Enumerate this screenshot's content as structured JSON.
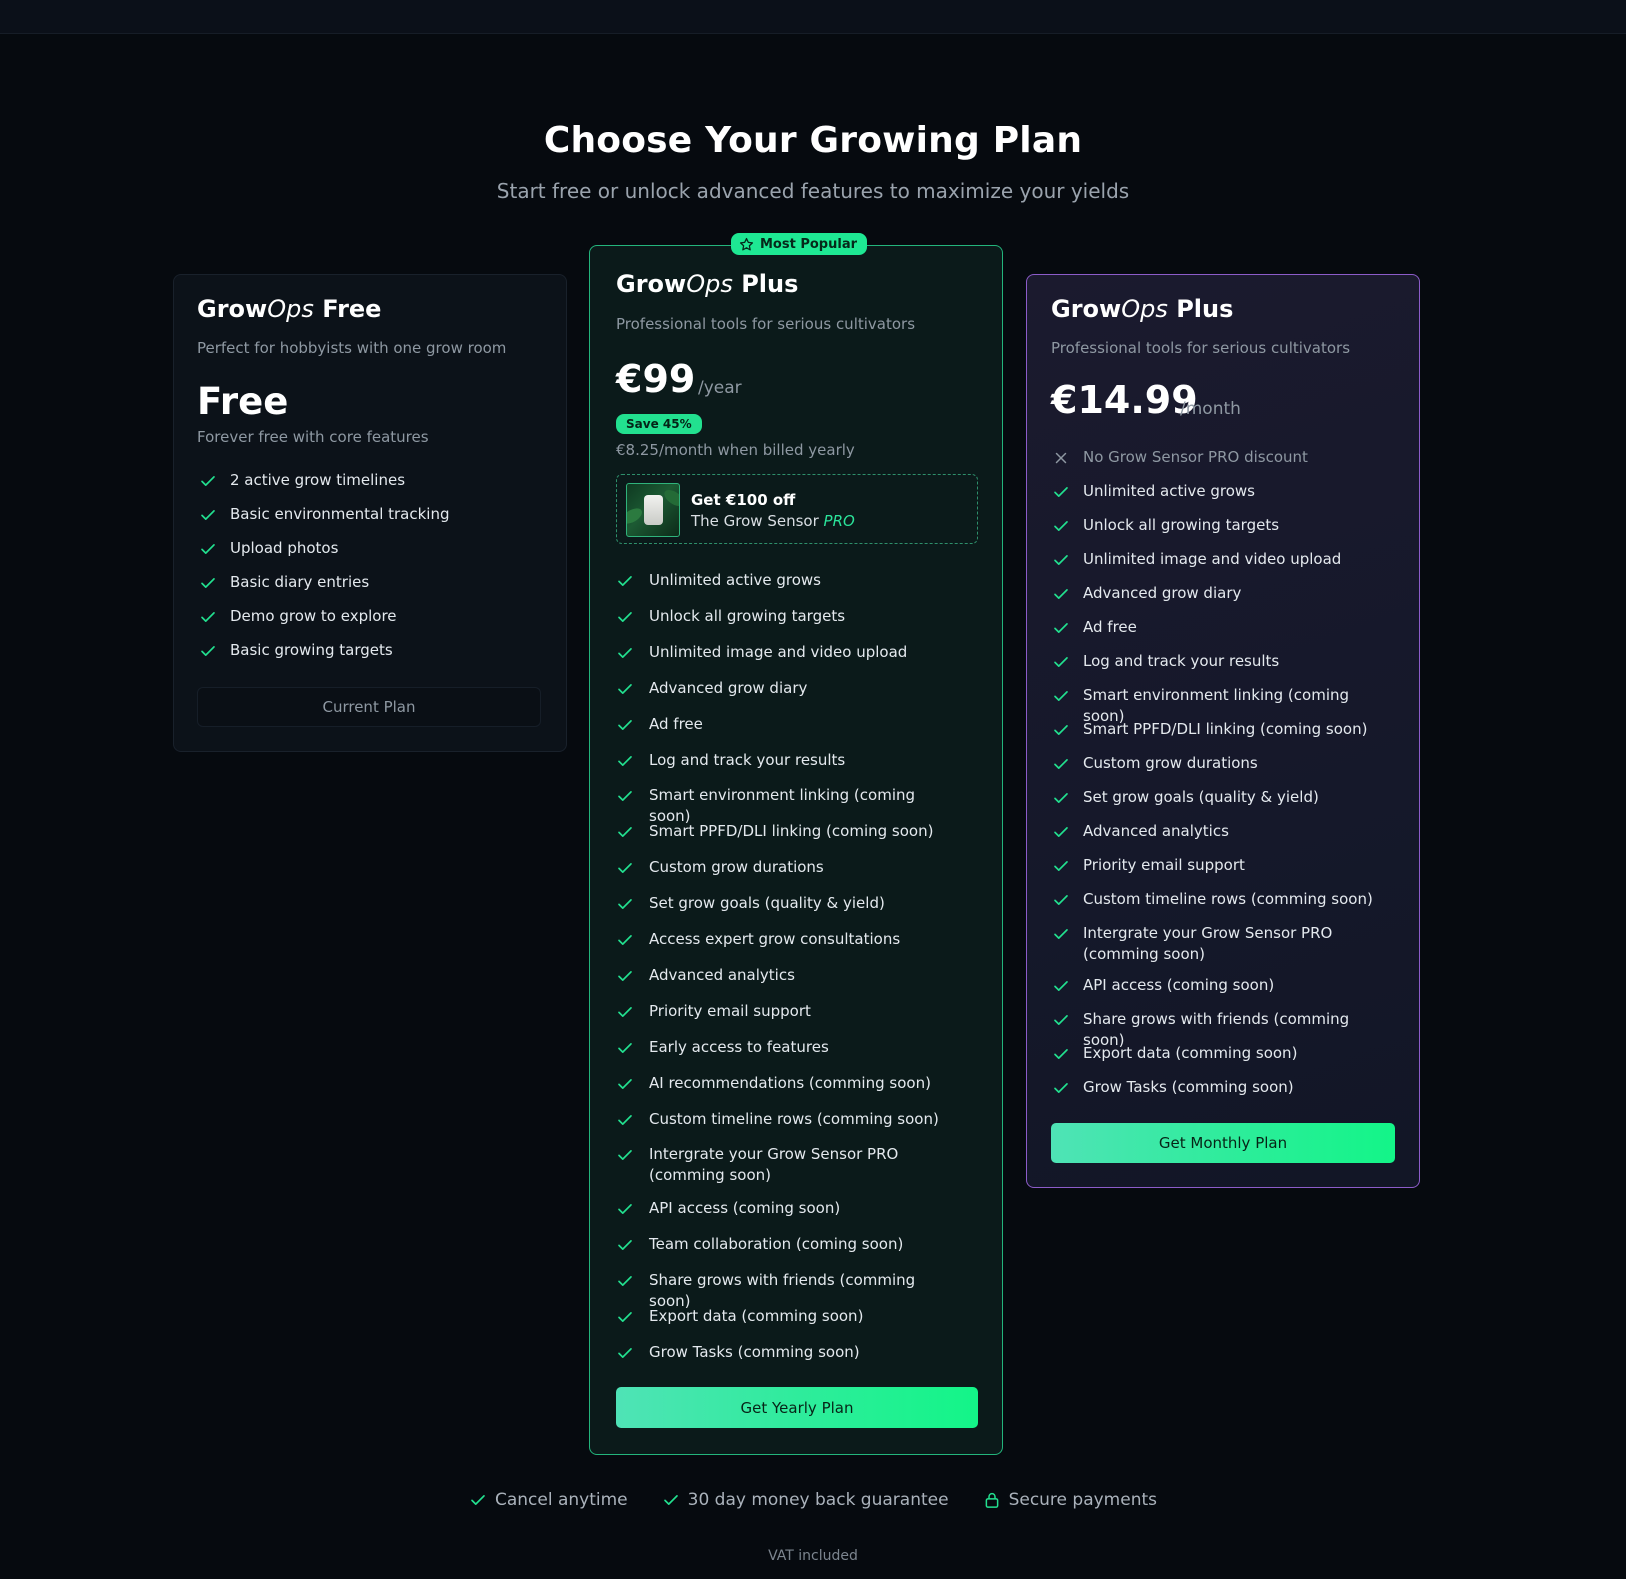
{
  "hero": {
    "title": "Choose Your Growing Plan",
    "subtitle": "Start free or unlock advanced features to maximize your yields"
  },
  "brand": {
    "grow": "Grow",
    "ops": "Ops"
  },
  "free_plan": {
    "name_suffix": "Free",
    "description": "Perfect for hobbyists with one grow room",
    "price": "Free",
    "price_note": "Forever free with core features",
    "features": [
      "2 active grow timelines",
      "Basic environmental tracking",
      "Upload photos",
      "Basic diary entries",
      "Demo grow to explore",
      "Basic growing targets"
    ],
    "button_label": "Current Plan"
  },
  "yearly_plan": {
    "badge": "Most Popular",
    "name_suffix": "Plus",
    "description": "Professional tools for serious cultivators",
    "price": "€99",
    "period": "/year",
    "save_badge": "Save 45%",
    "monthly_equiv": "€8.25/month when billed yearly",
    "promo": {
      "title": "Get €100 off",
      "subtitle_prefix": "The Grow Sensor ",
      "subtitle_pro": "PRO"
    },
    "features": [
      "Unlimited active grows",
      "Unlock all growing targets",
      "Unlimited image and video upload",
      "Advanced grow diary",
      "Ad free",
      "Log and track your results",
      "Smart environment linking (coming soon)",
      "Smart PPFD/DLI linking (coming soon)",
      "Custom grow durations",
      "Set grow goals (quality & yield)",
      "Access expert grow consultations",
      "Advanced analytics",
      "Priority email support",
      "Early access to features",
      "AI recommendations (comming soon)",
      "Custom timeline rows (comming soon)",
      "Intergrate your Grow Sensor PRO (comming soon)",
      "API access (coming soon)",
      "Team collaboration (coming soon)",
      "Share grows with friends (comming soon)",
      "Export data (comming soon)",
      "Grow Tasks (comming soon)"
    ],
    "button_label": "Get Yearly Plan"
  },
  "monthly_plan": {
    "name_suffix": "Plus",
    "description": "Professional tools for serious cultivators",
    "price": "€14.99",
    "period": "/month",
    "excluded_feature": "No Grow Sensor PRO discount",
    "features": [
      "Unlimited active grows",
      "Unlock all growing targets",
      "Unlimited image and video upload",
      "Advanced grow diary",
      "Ad free",
      "Log and track your results",
      "Smart environment linking (coming soon)",
      "Smart PPFD/DLI linking (coming soon)",
      "Custom grow durations",
      "Set grow goals (quality & yield)",
      "Advanced analytics",
      "Priority email support",
      "Custom timeline rows (comming soon)",
      "Intergrate your Grow Sensor PRO (comming soon)",
      "API access (coming soon)",
      "Share grows with friends (comming soon)",
      "Export data (comming soon)",
      "Grow Tasks (comming soon)"
    ],
    "button_label": "Get Monthly Plan"
  },
  "assurances": [
    {
      "icon": "check-icon",
      "label": "Cancel anytime"
    },
    {
      "icon": "check-icon",
      "label": "30 day money back guarantee"
    },
    {
      "icon": "lock-icon",
      "label": "Secure payments"
    }
  ],
  "vat_note": "VAT included",
  "colors": {
    "accent": "#22e08f",
    "yearly_border": "#23b57c",
    "monthly_border": "#8c5cc9",
    "background": "#060a0f"
  }
}
